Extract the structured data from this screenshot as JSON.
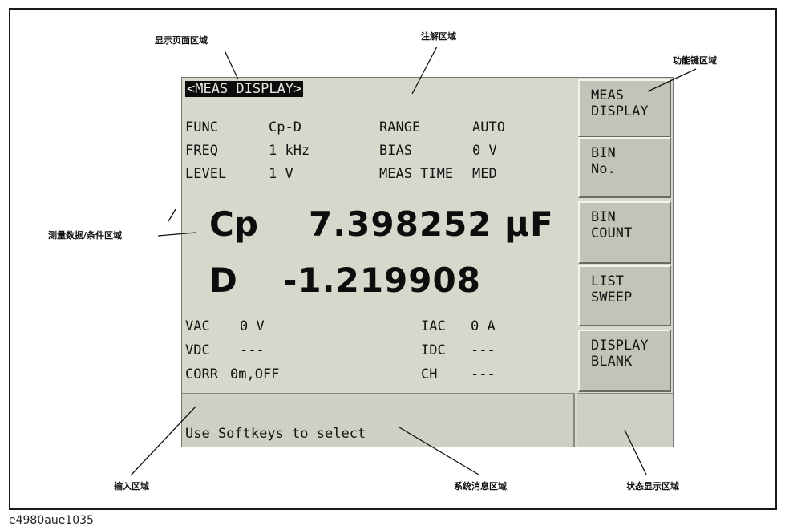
{
  "callouts": {
    "display_page_area": "显示页面区域",
    "annotation_area": "注解区域",
    "function_key_area": "功能键区域",
    "measurement_data_area": "测量数据/条件区域",
    "input_area": "输入区域",
    "system_message_area": "系统消息区域",
    "status_display_area": "状态显示区域"
  },
  "figure_id": "e4980aue1035",
  "screen": {
    "page_title": "<MEAS DISPLAY>",
    "params": {
      "func_label": "FUNC",
      "func_value": "Cp-D",
      "freq_label": "FREQ",
      "freq_value": "1 kHz",
      "level_label": "LEVEL",
      "level_value": "1 V",
      "range_label": "RANGE",
      "range_value": "AUTO",
      "bias_label": "BIAS",
      "bias_value": "0 V",
      "meas_time_label": "MEAS TIME",
      "meas_time_value": "MED"
    },
    "primary": {
      "label": "Cp",
      "value": "7.398252 µF"
    },
    "secondary": {
      "label": "D",
      "value": "-1.219908"
    },
    "monitors": {
      "vac_label": "VAC",
      "vac_value": "0 V",
      "vdc_label": "VDC",
      "vdc_value": "---",
      "corr_label": "CORR",
      "corr_value": "0m,OFF",
      "iac_label": "IAC",
      "iac_value": "0 A",
      "idc_label": "IDC",
      "idc_value": "---",
      "ch_label": "CH",
      "ch_value": "---"
    },
    "softkeys": [
      {
        "line1": "MEAS",
        "line2": "DISPLAY"
      },
      {
        "line1": "BIN",
        "line2": "No."
      },
      {
        "line1": "BIN",
        "line2": "COUNT"
      },
      {
        "line1": "LIST",
        "line2": "SWEEP"
      },
      {
        "line1": "DISPLAY",
        "line2": "BLANK"
      }
    ],
    "system_message": "Use Softkeys to select"
  }
}
